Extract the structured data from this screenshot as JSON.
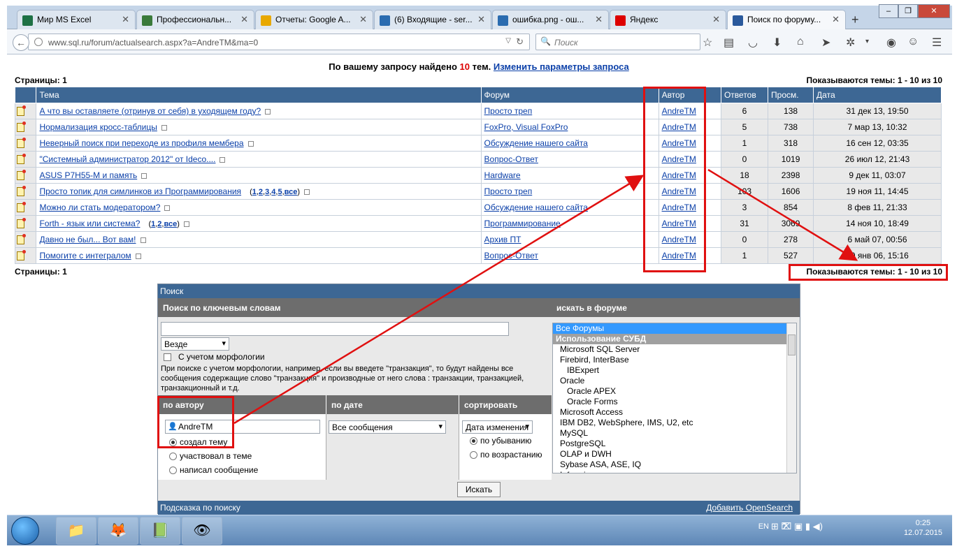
{
  "browser": {
    "tabs": [
      {
        "label": "Мир MS Excel",
        "icon": "excel-icon",
        "color": "#1e7145"
      },
      {
        "label": "Профессиональн...",
        "icon": "image-icon",
        "color": "#3a7a3a"
      },
      {
        "label": "Отчеты: Google A...",
        "icon": "analytics-icon",
        "color": "#e8a800"
      },
      {
        "label": "(6) Входящие - ser...",
        "icon": "mail-icon",
        "color": "#2b6cb0"
      },
      {
        "label": "ошибка.png - ош...",
        "icon": "file-icon",
        "color": "#2b6cb0"
      },
      {
        "label": "Яндекс",
        "icon": "yandex-icon",
        "color": "#d00"
      },
      {
        "label": "Поиск по форуму...",
        "icon": "sqlru-icon",
        "color": "#2b5a9c"
      }
    ],
    "url": "www.sql.ru/forum/actualsearch.aspx?a=AndreTM&ma=0",
    "search_placeholder": "Поиск"
  },
  "results": {
    "prefix": "По вашему запросу найдено",
    "count": "10",
    "suffix": "тем.",
    "change_link": "Изменить параметры запроса",
    "pages_label": "Страницы:",
    "pages_value": "1",
    "showing": "Показываются темы: 1 - 10 из 10"
  },
  "table": {
    "headers": [
      "Тема",
      "Форум",
      "Автор",
      "Ответов",
      "Просм.",
      "Дата"
    ],
    "rows": [
      {
        "topic": "А что вы оставляете (отринув от себя) в уходящем году?",
        "pages": "",
        "forum": "Просто треп",
        "author": "AndreTM",
        "replies": "6",
        "views": "138",
        "date": "31 дек 13, 19:50"
      },
      {
        "topic": "Нормализация кросс-таблицы",
        "pages": "",
        "forum": "FoxPro, Visual FoxPro",
        "author": "AndreTM",
        "replies": "5",
        "views": "738",
        "date": "7 мар 13, 10:32"
      },
      {
        "topic": "Неверный поиск при переходе из профиля мембера",
        "pages": "",
        "forum": "Обсуждение нашего сайта",
        "author": "AndreTM",
        "replies": "1",
        "views": "318",
        "date": "16 сен 12, 03:35"
      },
      {
        "topic": "\"Системный администратор 2012\" от Ideco....",
        "pages": "",
        "forum": "Вопрос-Ответ",
        "author": "AndreTM",
        "replies": "0",
        "views": "1019",
        "date": "26 июл 12, 21:43"
      },
      {
        "topic": "ASUS P7H55-M и память",
        "pages": "",
        "forum": "Hardware",
        "author": "AndreTM",
        "replies": "18",
        "views": "2398",
        "date": "9 дек 11, 03:07"
      },
      {
        "topic": "Просто топик для симлинков из Программирования",
        "pages": "1,2,3,4,5,все",
        "forum": "Просто треп",
        "author": "AndreTM",
        "replies": "103",
        "views": "1606",
        "date": "19 ноя 11, 14:45"
      },
      {
        "topic": "Можно ли стать модератором?",
        "pages": "",
        "forum": "Обсуждение нашего сайта",
        "author": "AndreTM",
        "replies": "3",
        "views": "854",
        "date": "8 фев 11, 21:33"
      },
      {
        "topic": "Forth - язык или система?",
        "pages": "1,2,все",
        "forum": "Программирование",
        "author": "AndreTM",
        "replies": "31",
        "views": "3069",
        "date": "14 ноя 10, 18:49"
      },
      {
        "topic": "Давно не был... Вот вам!",
        "pages": "",
        "forum": "Архив ПТ",
        "author": "AndreTM",
        "replies": "0",
        "views": "278",
        "date": "6 май 07, 00:56"
      },
      {
        "topic": "Помогите с интегралом",
        "pages": "",
        "forum": "Вопрос-Ответ",
        "author": "AndreTM",
        "replies": "1",
        "views": "527",
        "date": "20 янв 06, 15:16"
      }
    ]
  },
  "search": {
    "title": "Поиск",
    "keywords_header": "Поиск по ключевым словам",
    "forum_header": "искать в форуме",
    "where_value": "Везде",
    "morph_label": "С учетом морфологии",
    "hint": "При поиске с учетом морфологии, например, если вы введете \"транзакция\", то будут найдены все сообщения содержащие слово \"транзакция\" и производные от него слова : транзакции, транзакцией, транзакционный и т.д.",
    "author_header": "по автору",
    "date_header": "по дате",
    "sort_header": "сортировать",
    "author_value": "AndreTM",
    "author_opts": [
      "создал тему",
      "участвовал в теме",
      "написал сообщение"
    ],
    "date_value": "Все сообщения",
    "sort_value": "Дата изменения",
    "sort_opts": [
      "по убыванию",
      "по возрастанию"
    ],
    "forums": [
      "Все Форумы",
      "Использование СУБД",
      "Microsoft SQL Server",
      "Firebird, InterBase",
      "IBExpert",
      "Oracle",
      "Oracle APEX",
      "Oracle Forms",
      "Microsoft Access",
      "IBM DB2, WebSphere, IMS, U2, etc",
      "MySQL",
      "PostgreSQL",
      "OLAP и DWH",
      "Sybase ASA, ASE, IQ",
      "Informix"
    ],
    "button": "Искать",
    "footer_left": "Подсказка по поиску",
    "footer_right": "Добавить OpenSearch"
  },
  "taskbar": {
    "lang": "EN",
    "time": "0:25",
    "date": "12.07.2015"
  },
  "colors": {
    "header_blue": "#3d6794",
    "annotation_red": "#e01010",
    "link": "#0a3fa8"
  }
}
